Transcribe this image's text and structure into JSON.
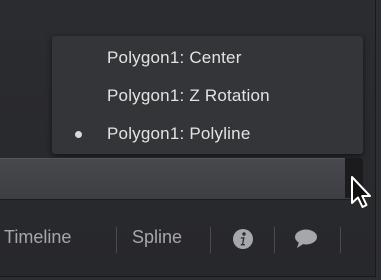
{
  "dropdown": {
    "items": [
      {
        "label": "Polygon1: Center",
        "selected": false
      },
      {
        "label": "Polygon1: Z Rotation",
        "selected": false
      },
      {
        "label": "Polygon1: Polyline",
        "selected": true
      }
    ]
  },
  "toolbar": {
    "timeline_label": "Timeline",
    "spline_label": "Spline",
    "icons": [
      "info-icon",
      "comment-icon"
    ]
  },
  "colors": {
    "menu_bg": "#343539",
    "menu_text": "#e3e3e3",
    "toolbar_text": "#a6a7ab",
    "panel_bg": "#2c2d31"
  }
}
